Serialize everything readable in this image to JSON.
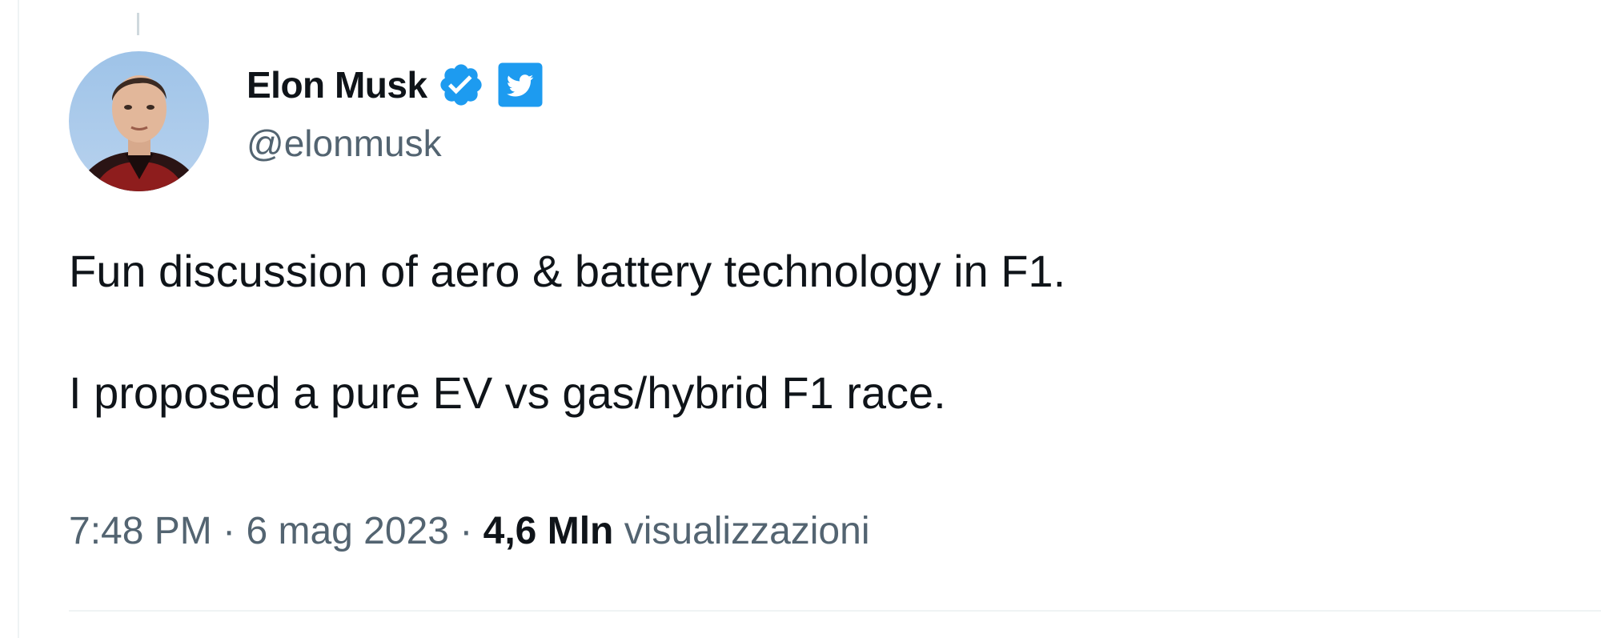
{
  "author": {
    "display_name": "Elon Musk",
    "handle": "@elonmusk",
    "verified": true
  },
  "tweet": {
    "lines": [
      "Fun discussion of aero & battery technology in F1.",
      "I proposed a pure EV vs gas/hybrid F1 race."
    ]
  },
  "meta": {
    "time": "7:48 PM",
    "separator": "·",
    "date": "6 mag 2023",
    "views_count": "4,6 Mln",
    "views_label": "visualizzazioni"
  },
  "icons": {
    "verified": "verified-badge-icon",
    "badge": "twitter-bird-icon"
  },
  "colors": {
    "accent": "#1d9bf0",
    "text_primary": "#0f1419",
    "text_secondary": "#536471"
  }
}
